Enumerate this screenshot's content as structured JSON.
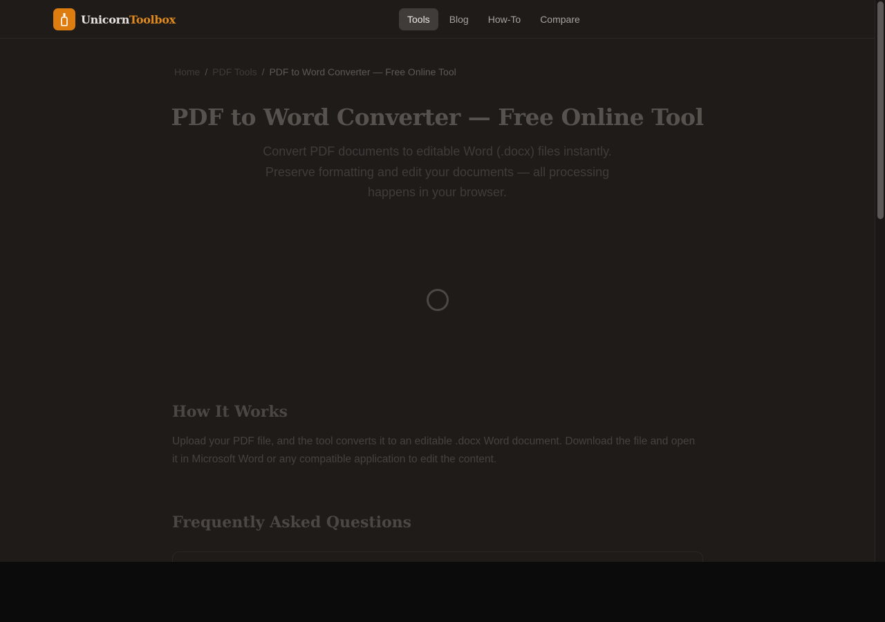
{
  "header": {
    "brand_part1": "Unicorn",
    "brand_part2": "Toolbox",
    "brand_color": "#dd7d10",
    "nav": [
      {
        "label": "Tools",
        "active": true
      },
      {
        "label": "Blog",
        "active": false
      },
      {
        "label": "How-To",
        "active": false
      },
      {
        "label": "Compare",
        "active": false
      }
    ]
  },
  "breadcrumb": {
    "home": "Home",
    "sep": "/",
    "section": "PDF Tools",
    "current": "PDF to Word Converter — Free Online Tool"
  },
  "page": {
    "title": "PDF to Word Converter — Free Online Tool",
    "subtitle": "Convert PDF documents to editable Word (.docx) files instantly. Preserve formatting and edit your documents — all processing happens in your browser."
  },
  "how_it_works": {
    "heading": "How It Works",
    "text": "Upload your PDF file, and the tool converts it to an editable .docx Word document. Download the file and open it in Microsoft Word or any compatible application to edit the content."
  },
  "faq": {
    "heading": "Frequently Asked Questions"
  },
  "icons": {
    "logo": "bottle-icon",
    "loading": "spinner-icon"
  }
}
